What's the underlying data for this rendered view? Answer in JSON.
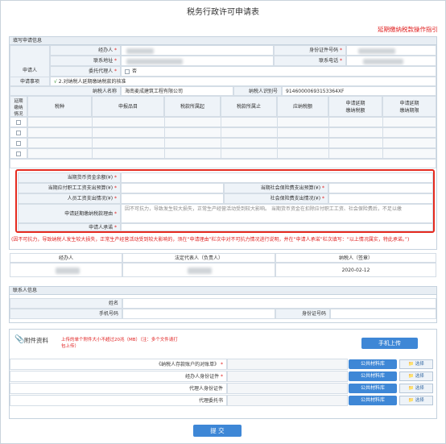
{
  "page": {
    "title": "税务行政许可申请表",
    "guide_link": "延期缴纳税款操作指引"
  },
  "applicant_section": {
    "heading": "填写申请信息",
    "applicant_label": "申请人",
    "handler_label": "经办人",
    "phone_label": "联系电话",
    "id_type_label": "身份证件号码",
    "address_label": "联系地址",
    "agent_label": "委托代理人",
    "agent_option": "否",
    "matter_label": "申请事项",
    "matter_value": "2.对纳税人延期缴纳税款的核准",
    "taxpayer_name_label": "纳税人名称",
    "taxpayer_name_value": "海南麦成建筑工程有限公司",
    "taxpayer_id_label": "纳税人识别号",
    "taxpayer_id_value": "91460000693153364XF"
  },
  "tax_table": {
    "headers": [
      "延期\n缴纳\n情况",
      "税种",
      "申报品目",
      "税款所属起",
      "税款所属止",
      "应纳税额",
      "申请延期\n缴纳税额",
      "申请延期\n缴纳期限"
    ]
  },
  "reason_section": {
    "current_funds": "当期货币资金余额(¥)",
    "wage_payment": "当期应付职工工资支出预算(¥)",
    "social_insurance": "当期社会保险费支出预算(¥)",
    "staff_wage_actual": "人员工资支出情况(¥)",
    "social_actual": "社会保险费支出情况(¥)",
    "reason_label": "申请延期缴纳税款理由",
    "reason_text": "因不可抗力，导致发生较大损失，正常生产经营活动受到较大影响。    当期货币资金在扣除应付职工工资、社会保险费后，不足以缴",
    "commitment_label": "申请人承诺"
  },
  "note": "(因不可抗力，导致纳税人发生较大损失，正常生产经营活动受到较大影响的，须在“申请理由”栏次中对不可抗力情况进行说明，并在“申请人承诺”栏次填写：“以上情况属实，特此承诺。”)",
  "signature_row": {
    "handler_label": "经办人",
    "legal_rep_label": "法定代表人（负责人）",
    "taxpayer_seal_label": "纳税人（签章）",
    "date": "2020-02-12"
  },
  "contact_section": {
    "heading": "联系人信息",
    "name_label": "姓名",
    "phone_label": "手机号码",
    "id_label": "身份证号码"
  },
  "attachments": {
    "heading": "附件资料",
    "hint": "上传的单个附件大小不超过20兆（MB）（注：多个文件请打包上传）",
    "mobile_upload": "手机上传",
    "items": [
      {
        "label": "《纳税人存款账户的对账单》",
        "required": true
      },
      {
        "label": "经办人身份证件",
        "required": true
      },
      {
        "label": "代理人身份证件",
        "required": false
      },
      {
        "label": "代理委托书",
        "required": false
      }
    ],
    "public_library": "公共材料库",
    "choose": "选择"
  },
  "submit_label": "提 交"
}
